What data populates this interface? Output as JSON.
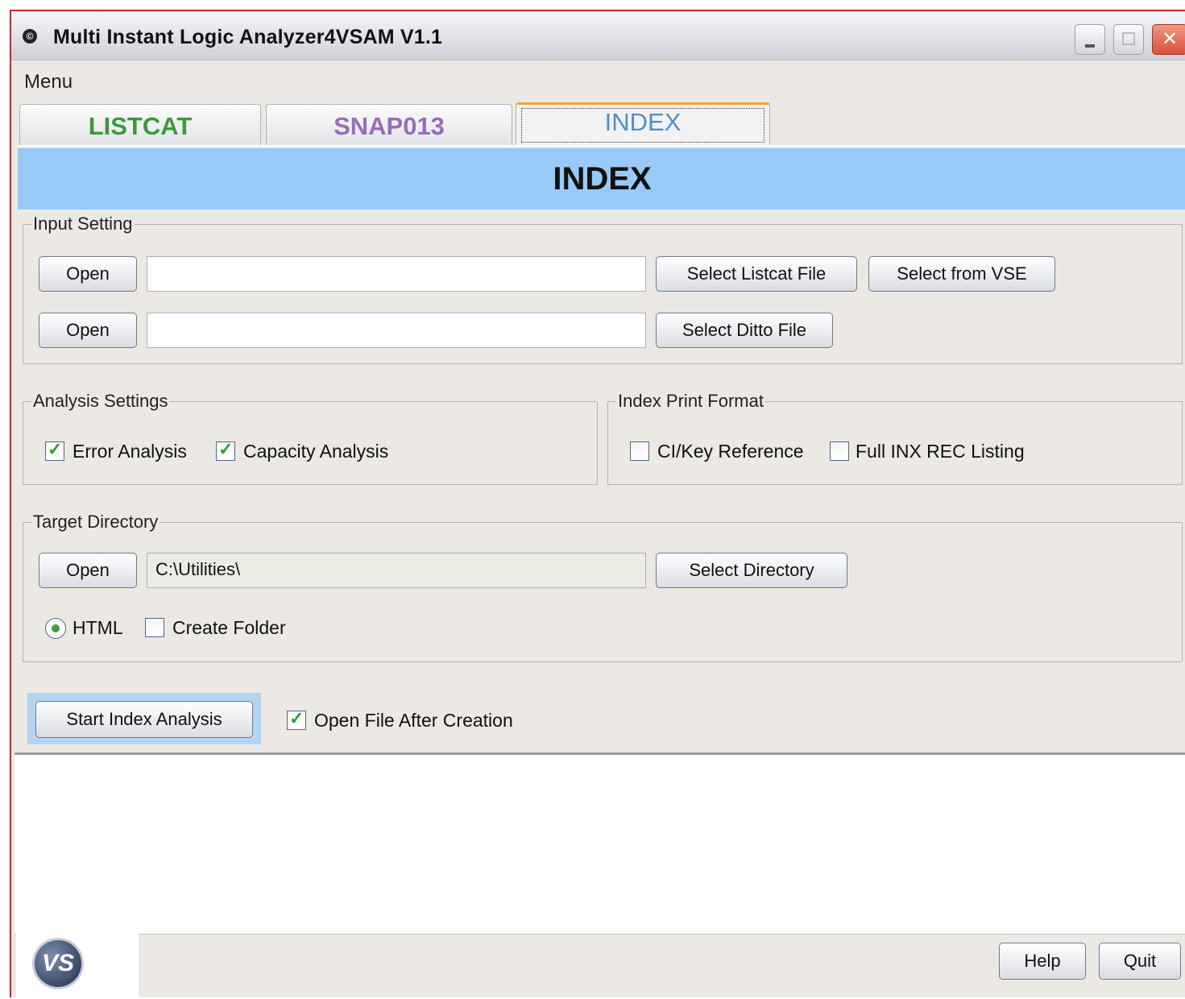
{
  "window": {
    "title": "Multi Instant Logic Analyzer4VSAM V1.1"
  },
  "menu": {
    "label": "Menu"
  },
  "tabs": [
    {
      "label": "LISTCAT",
      "active": false,
      "color": "#3a9a3a"
    },
    {
      "label": "SNAP013",
      "active": false,
      "color": "#9a6cb9"
    },
    {
      "label": "INDEX",
      "active": true,
      "color": "#4d8fd0"
    }
  ],
  "banner": {
    "title": "INDEX",
    "color": "#99c9f7"
  },
  "input_setting": {
    "legend": "Input Setting",
    "row1": {
      "open_label": "Open",
      "value": "",
      "select_label": "Select Listcat File",
      "vse_label": "Select from VSE"
    },
    "row2": {
      "open_label": "Open",
      "value": "",
      "select_label": "Select Ditto File"
    }
  },
  "analysis_settings": {
    "legend": "Analysis Settings",
    "error_analysis": {
      "label": "Error Analysis",
      "checked": true
    },
    "capacity_analysis": {
      "label": "Capacity Analysis",
      "checked": true
    }
  },
  "index_print_format": {
    "legend": "Index Print Format",
    "ci_key_reference": {
      "label": "CI/Key Reference",
      "checked": false
    },
    "full_inx_rec_listing": {
      "label": "Full INX REC Listing",
      "checked": false
    }
  },
  "target_directory": {
    "legend": "Target Directory",
    "open_label": "Open",
    "value": "C:\\Utilities\\",
    "select_label": "Select Directory",
    "html_radio": {
      "label": "HTML",
      "selected": true
    },
    "create_folder": {
      "label": "Create Folder",
      "checked": false
    }
  },
  "actions": {
    "start_label": "Start Index Analysis",
    "open_after": {
      "label": "Open File After Creation",
      "checked": true
    }
  },
  "footer": {
    "help_label": "Help",
    "quit_label": "Quit",
    "logo_text": "VS"
  }
}
